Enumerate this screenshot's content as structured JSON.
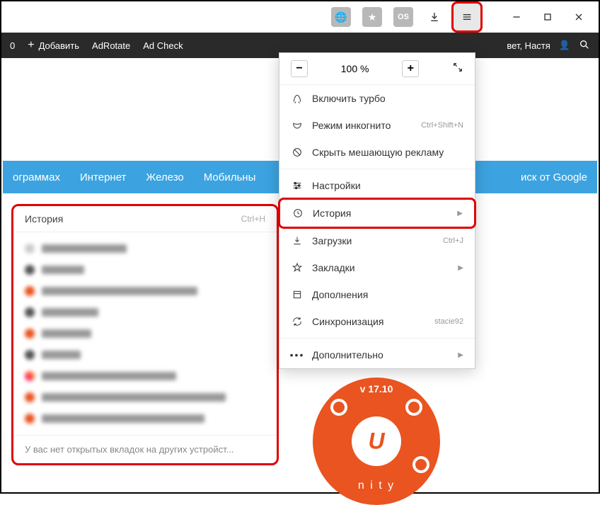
{
  "titlebar": {
    "icons": [
      "globe",
      "star",
      "os",
      "download",
      "menu",
      "minimize",
      "maximize",
      "close"
    ]
  },
  "toolbar": {
    "zero": "0",
    "add": "Добавить",
    "adrotate": "AdRotate",
    "adcheck": "Ad Check",
    "greeting": "вет, Настя"
  },
  "bluebar": {
    "items": [
      "ограммах",
      "Интернет",
      "Железо",
      "Мобильны"
    ],
    "right": "иск от Google"
  },
  "history_submenu": {
    "title": "История",
    "shortcut": "Ctrl+H",
    "footer": "У вас нет открытых вкладок на других устройст..."
  },
  "menu": {
    "zoom": {
      "minus": "−",
      "level": "100 %",
      "plus": "+"
    },
    "turbo": "Включить турбо",
    "incognito": {
      "label": "Режим инкогнито",
      "shortcut": "Ctrl+Shift+N"
    },
    "hideads": "Скрыть мешающую рекламу",
    "settings": "Настройки",
    "history": "История",
    "downloads": {
      "label": "Загрузки",
      "shortcut": "Ctrl+J"
    },
    "bookmarks": "Закладки",
    "addons": "Дополнения",
    "sync": {
      "label": "Синхронизация",
      "user": "stacie92"
    },
    "more": "Дополнительно"
  },
  "ubuntu": {
    "version": "v 17.10",
    "unity": "n i t y"
  }
}
